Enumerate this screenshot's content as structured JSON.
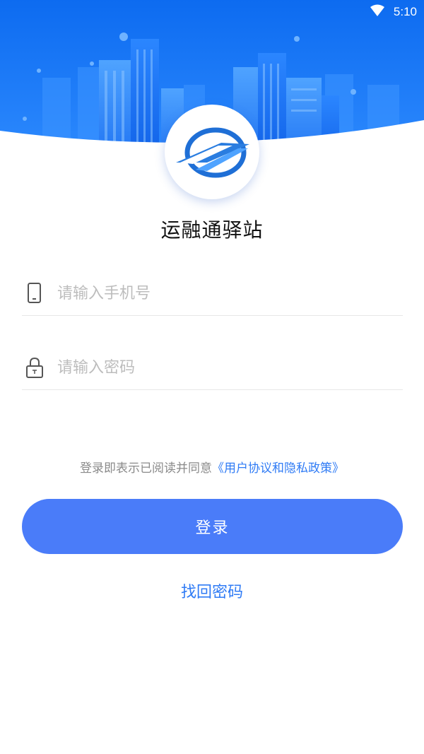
{
  "status_bar": {
    "time": "5:10",
    "wifi_icon": "wifi-icon"
  },
  "app": {
    "name": "运融通驿站",
    "logo_icon": "road-logo-icon"
  },
  "colors": {
    "primary": "#4a7cf9",
    "link": "#2f7bf5",
    "hero_blue": "#1a76f3"
  },
  "form": {
    "phone": {
      "placeholder": "请输入手机号",
      "value": "",
      "icon": "phone-icon"
    },
    "password": {
      "placeholder": "请输入密码",
      "value": "",
      "icon": "lock-icon"
    }
  },
  "agreement": {
    "prefix": "登录即表示已阅读并同意",
    "link": "《用户协议和隐私政策》"
  },
  "login_label": "登录",
  "forgot_label": "找回密码"
}
